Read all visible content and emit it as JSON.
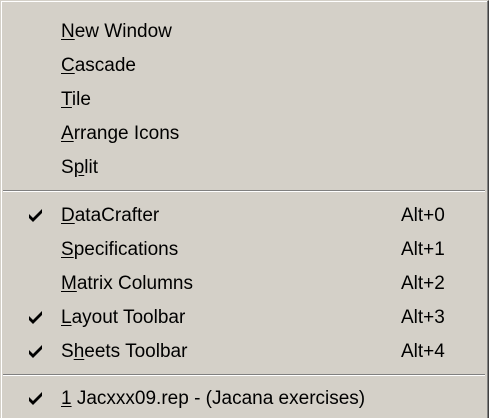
{
  "menu": {
    "group1": [
      {
        "pre": "",
        "key": "N",
        "post": "ew Window"
      },
      {
        "pre": "",
        "key": "C",
        "post": "ascade"
      },
      {
        "pre": "",
        "key": "T",
        "post": "ile"
      },
      {
        "pre": "",
        "key": "A",
        "post": "rrange Icons"
      },
      {
        "pre": "S",
        "key": "p",
        "post": "lit"
      }
    ],
    "group2": [
      {
        "pre": "",
        "key": "D",
        "post": "ataCrafter",
        "shortcut": "Alt+0",
        "checked": true
      },
      {
        "pre": "",
        "key": "S",
        "post": "pecifications",
        "shortcut": "Alt+1",
        "checked": false
      },
      {
        "pre": "",
        "key": "M",
        "post": "atrix Columns",
        "shortcut": "Alt+2",
        "checked": false
      },
      {
        "pre": "",
        "key": "L",
        "post": "ayout Toolbar",
        "shortcut": "Alt+3",
        "checked": true
      },
      {
        "pre": "S",
        "key": "h",
        "post": "eets Toolbar",
        "shortcut": "Alt+4",
        "checked": true
      }
    ],
    "group3": [
      {
        "pre": "",
        "key": "1",
        "post": " Jacxxx09.rep - (Jacana exercises)",
        "checked": true
      }
    ],
    "check_glyph": "check-mark-icon"
  }
}
